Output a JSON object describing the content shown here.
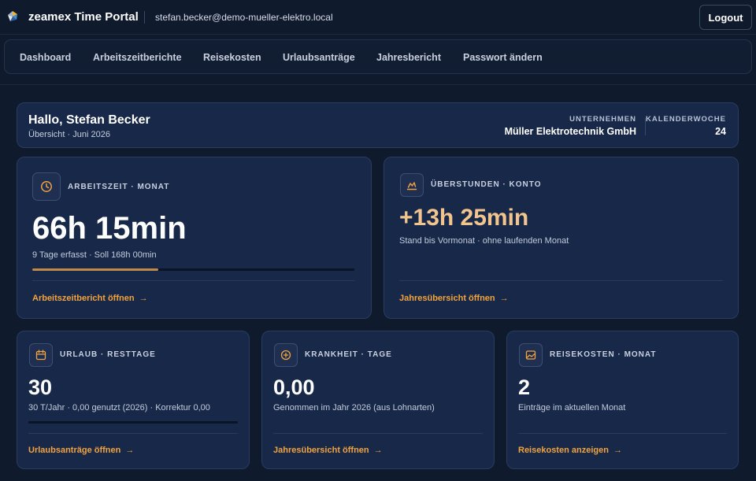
{
  "app": {
    "title": "zeamex Time Portal",
    "user_email": "stefan.becker@demo-mueller-elektro.local",
    "logout_label": "Logout"
  },
  "nav": {
    "items": [
      {
        "label": "Dashboard"
      },
      {
        "label": "Arbeitszeitberichte"
      },
      {
        "label": "Reisekosten"
      },
      {
        "label": "Urlaubsanträge"
      },
      {
        "label": "Jahresbericht"
      },
      {
        "label": "Passwort ändern"
      }
    ]
  },
  "header": {
    "greeting": "Hallo, Stefan Becker",
    "subtitle": "Übersicht · Juni 2026",
    "company_label": "UNTERNEHMEN",
    "company_value": "Müller Elektrotechnik GmbH",
    "week_label": "KALENDERWOCHE",
    "week_value": "24"
  },
  "cards": {
    "arbeitszeit": {
      "label": "ARBEITSZEIT · MONAT",
      "value": "66h 15min",
      "sub": "9 Tage erfasst · Soll 168h 00min",
      "progress": 0.39,
      "link": "Arbeitszeitbericht öffnen",
      "icon": "clock-icon"
    },
    "ueberstunden": {
      "label": "ÜBERSTUNDEN · KONTO",
      "value": "+13h 25min",
      "sub": "Stand bis Vormonat · ohne laufenden Monat",
      "link": "Jahresübersicht öffnen",
      "icon": "chart-icon"
    },
    "urlaub": {
      "label": "URLAUB · RESTTAGE",
      "value": "30",
      "sub": "30 T/Jahr · 0,00 genutzt (2026) · Korrektur 0,00",
      "progress": 0,
      "link": "Urlaubsanträge öffnen",
      "icon": "calendar-icon"
    },
    "krankheit": {
      "label": "KRANKHEIT · TAGE",
      "value": "0,00",
      "sub": "Genommen im Jahr 2026 (aus Lohnarten)",
      "link": "Jahresübersicht öffnen",
      "icon": "plus-circle-icon"
    },
    "reisekosten": {
      "label": "REISEKOSTEN · MONAT",
      "value": "2",
      "sub": "Einträge im aktuellen Monat",
      "link": "Reisekosten anzeigen",
      "icon": "image-icon"
    }
  },
  "colors": {
    "background": "#0f1a2c",
    "card": "#182848",
    "accent": "#f0a340",
    "overtime": "#f2c48e"
  }
}
